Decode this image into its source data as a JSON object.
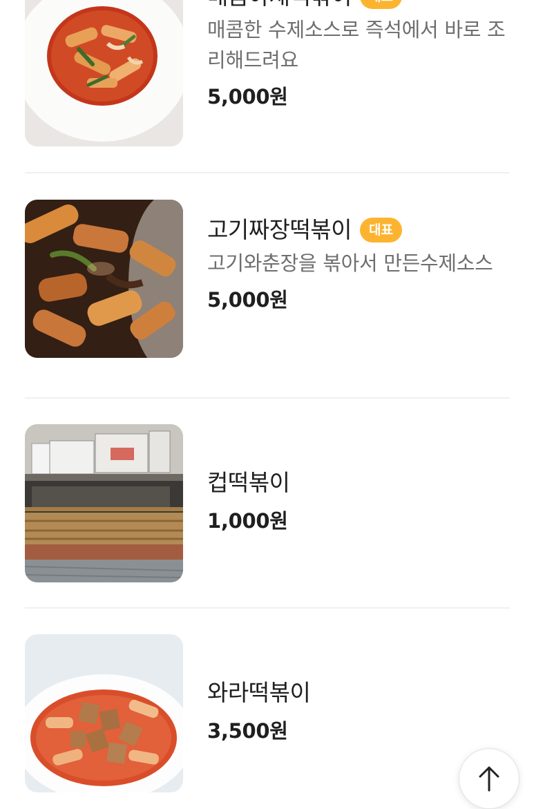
{
  "menu": {
    "items": [
      {
        "name": "매콤야채떡볶이",
        "badge": "대표",
        "description": "매콤한 수제소스로 즉석에서 바로 조리해드려요",
        "price": "5,000원",
        "image_icon": "spicy-tteokbokki-photo"
      },
      {
        "name": "고기짜장떡볶이",
        "badge": "대표",
        "description": "고기와춘장을 볶아서 만든수제소스",
        "price": "5,000원",
        "image_icon": "jjajang-tteokbokki-photo"
      },
      {
        "name": "컵떡볶이",
        "price": "1,000원",
        "image_icon": "storefront-photo"
      },
      {
        "name": "와라떡볶이",
        "price": "3,500원",
        "image_icon": "tteokbokki-fishcake-photo"
      }
    ]
  },
  "scroll_top": {
    "icon": "arrow-up-icon"
  },
  "colors": {
    "badge": "#fcb430",
    "text_primary": "#1f1f1f",
    "text_secondary": "#6e6e6e",
    "divider": "#f0f0f0"
  }
}
